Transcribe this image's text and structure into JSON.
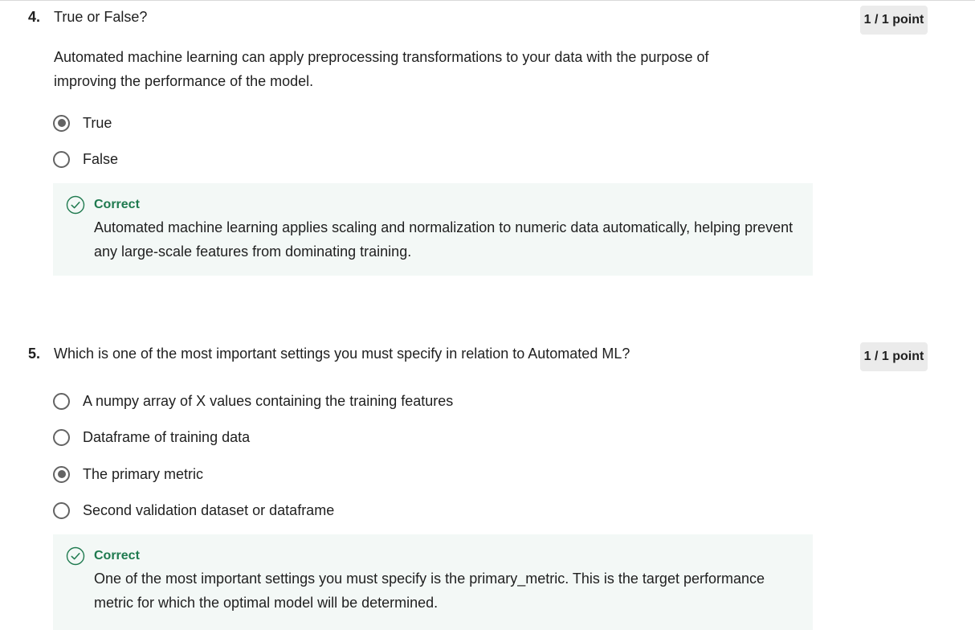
{
  "questions": [
    {
      "number": "4.",
      "title": "True or False?",
      "points": "1 / 1 point",
      "prompt": "Automated machine learning can apply preprocessing transformations to your data with the purpose of improving the performance of the model.",
      "options": [
        {
          "label": "True",
          "selected": true
        },
        {
          "label": "False",
          "selected": false
        }
      ],
      "feedback": {
        "status": "Correct",
        "icon": "check-circle-icon",
        "text": "Automated machine learning applies scaling and normalization to numeric data automatically, helping prevent any large-scale features from dominating training."
      }
    },
    {
      "number": "5.",
      "title": "Which is one of the most important settings you must specify in relation to Automated ML?",
      "points": "1 / 1 point",
      "options": [
        {
          "label": "A numpy array of X values containing the training features",
          "selected": false
        },
        {
          "label": "Dataframe of training data",
          "selected": false
        },
        {
          "label": "The primary metric",
          "selected": true
        },
        {
          "label": "Second validation dataset or dataframe",
          "selected": false
        }
      ],
      "feedback": {
        "status": "Correct",
        "icon": "check-circle-icon",
        "text": "One of the most important settings you must specify is the primary_metric. This is the target performance metric for which the optimal model will be determined."
      }
    }
  ],
  "colors": {
    "correct_green": "#1f7a4f",
    "feedback_bg": "#f3f8f6",
    "badge_bg": "#ebebeb",
    "radio_gray": "#636363"
  }
}
